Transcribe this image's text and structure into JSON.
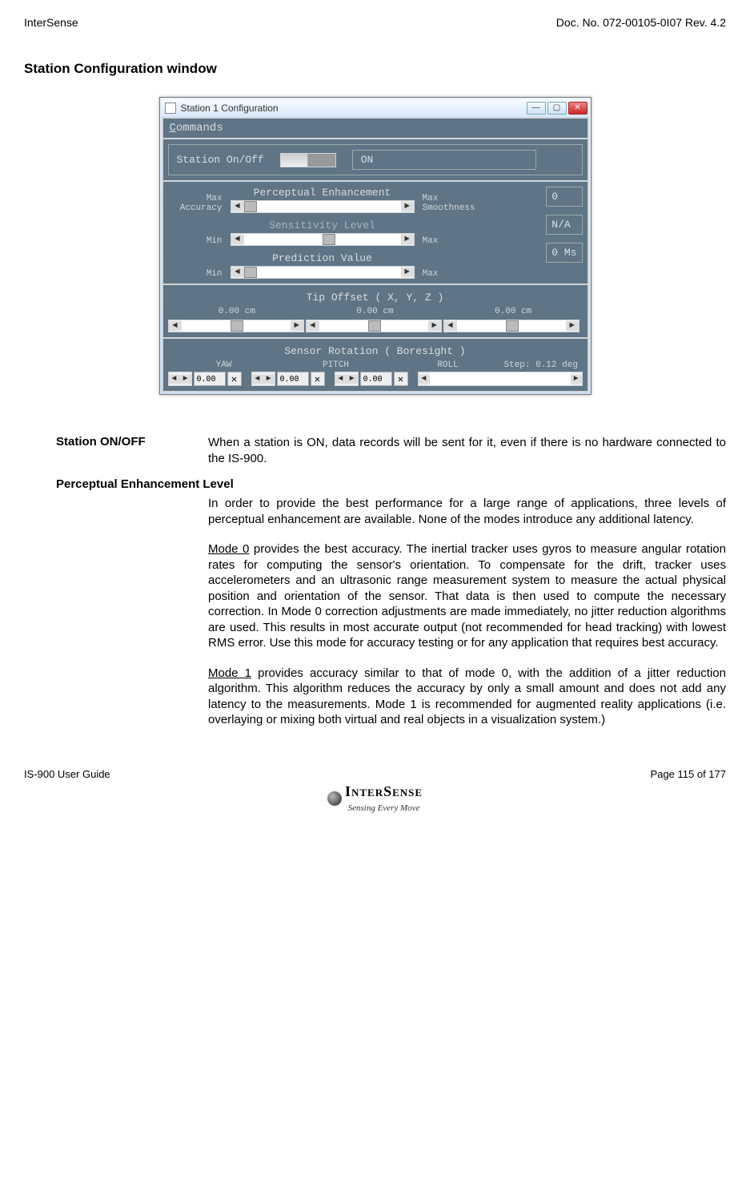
{
  "header": {
    "left": "InterSense",
    "right": "Doc. No. 072-00105-0I07 Rev. 4.2"
  },
  "section_title": "Station Configuration window",
  "window": {
    "title": "Station 1 Configuration",
    "menu": "Commands",
    "station_label": "Station On/Off",
    "on_label": "ON",
    "sliders": {
      "perceptual": {
        "left": "Max Accuracy",
        "title": "Perceptual Enhancement",
        "right": "Max Smoothness",
        "value": "0"
      },
      "sensitivity": {
        "left": "Min",
        "title": "Sensitivity Level",
        "right": "Max",
        "value": "N/A"
      },
      "prediction": {
        "left": "Min",
        "title": "Prediction Value",
        "right": "Max",
        "value": "0 Ms"
      }
    },
    "tip": {
      "title": "Tip Offset ( X, Y, Z )",
      "v1": "0.00 cm",
      "v2": "0.00 cm",
      "v3": "0.00 cm"
    },
    "sensor": {
      "title": "Sensor Rotation ( Boresight )",
      "yaw": "YAW",
      "pitch": "PITCH",
      "roll": "ROLL",
      "step": "Step: 0.12 deg",
      "val": "0.00"
    }
  },
  "defs": {
    "onoff": {
      "term": "Station ON/OFF",
      "body": "When a station is ON, data records will be sent for it, even if there is no hardware connected to the IS-900."
    },
    "perc_title": "Perceptual Enhancement Level",
    "perc_intro": "In order to provide the best performance for a large range of applications, three levels of perceptual enhancement are available.  None of the modes introduce any additional latency.",
    "mode0_label": "Mode 0",
    "mode0": " provides the best accuracy.  The inertial tracker uses gyros to measure angular rotation rates for computing the sensor's orientation.  To compensate for the drift, tracker uses accelerometers and an ultrasonic range measurement system to measure the actual physical position and orientation of the sensor.  That data is then used to compute the necessary correction.  In Mode 0 correction adjustments are made immediately, no jitter reduction algorithms are used.  This results in most accurate output (not recommended for head tracking) with lowest RMS error.  Use this mode for accuracy testing or for any application that requires best accuracy.",
    "mode1_label": "Mode 1",
    "mode1": " provides accuracy similar to that of mode 0, with the addition of a jitter reduction algorithm.  This algorithm reduces the accuracy by only a small amount and does not add any latency to the measurements.  Mode 1 is recommended for augmented reality applications (i.e. overlaying or mixing both virtual and real objects in a visualization system.)"
  },
  "footer": {
    "left": "IS-900 User Guide",
    "right": "Page 115 of 177"
  },
  "brand": {
    "name": "InterSense",
    "tag": "Sensing Every Move"
  }
}
